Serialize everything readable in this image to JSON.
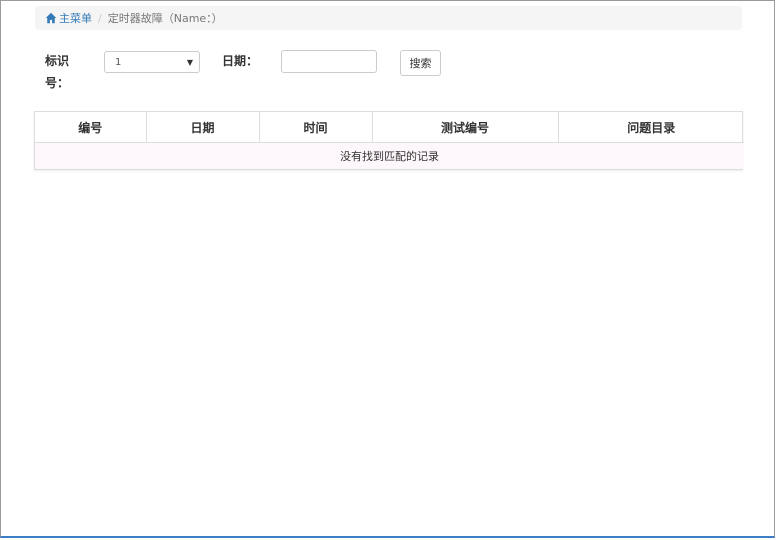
{
  "breadcrumb": {
    "home_label": "主菜单",
    "current": "定时器故障（Name：）"
  },
  "filters": {
    "id_label_line1": "标识",
    "id_label_line2": "号：",
    "id_value": "1",
    "date_label": "日期：",
    "date_value": "",
    "search_label": "搜索"
  },
  "table": {
    "columns": [
      "编号",
      "日期",
      "时间",
      "测试编号",
      "问题目录"
    ],
    "empty_message": "没有找到匹配的记录"
  },
  "colors": {
    "link": "#337ab7",
    "bottom_bar": "#3c7fc4"
  }
}
